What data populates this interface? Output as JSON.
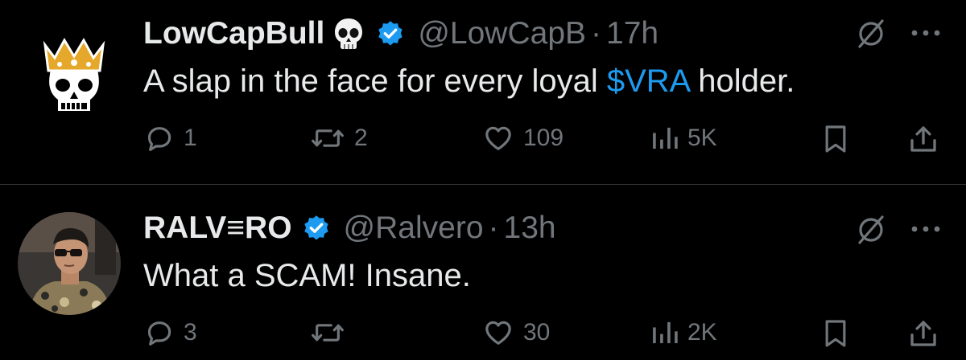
{
  "tweets": [
    {
      "display_name": "LowCapBull",
      "name_emoji": "skull-icon",
      "verified": true,
      "handle": "@LowCapB",
      "separator": "·",
      "time": "17h",
      "text_before": "A slap in the face for every loyal ",
      "cashtag": "$VRA",
      "text_after": " holder.",
      "avatar": "crowned-skull-avatar",
      "replies": "1",
      "reposts": "2",
      "likes": "109",
      "views": "5K"
    },
    {
      "display_name": "RALV≡RO",
      "verified": true,
      "handle": "@Ralvero",
      "separator": "·",
      "time": "13h",
      "text": "What a SCAM! Insane.",
      "avatar": "profile-photo-avatar",
      "replies": "3",
      "reposts": "",
      "likes": "30",
      "views": "2K"
    }
  ],
  "colors": {
    "background": "#000000",
    "primary_text": "#e7e9ea",
    "secondary_text": "#71767b",
    "accent": "#1d9bf0",
    "divider": "#2f3336"
  }
}
